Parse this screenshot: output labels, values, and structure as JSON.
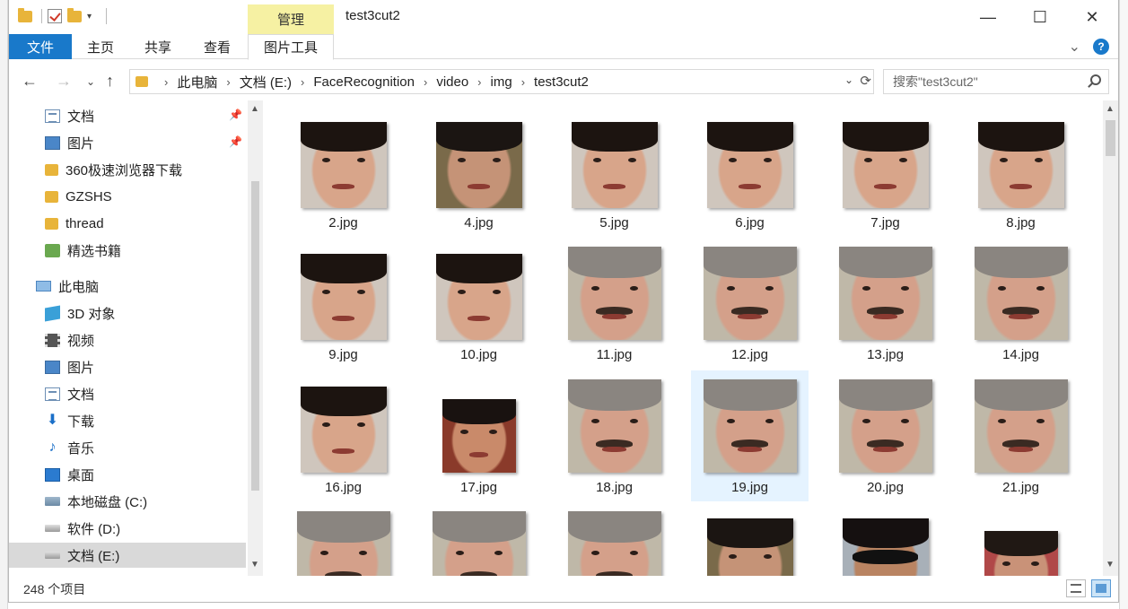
{
  "window": {
    "title": "test3cut2",
    "manage_tab": "管理",
    "minimize": "—",
    "maximize": "☐",
    "close": "✕"
  },
  "ribbon": {
    "tabs": [
      {
        "label": "文件"
      },
      {
        "label": "主页"
      },
      {
        "label": "共享"
      },
      {
        "label": "查看"
      },
      {
        "label": "图片工具"
      }
    ],
    "expand": "⌄",
    "help": "?"
  },
  "nav": {
    "back": "←",
    "forward": "→",
    "recent": "⌄",
    "up": "↑",
    "breadcrumb": [
      "此电脑",
      "文档 (E:)",
      "FaceRecognition",
      "video",
      "img",
      "test3cut2"
    ],
    "search_placeholder": "搜索\"test3cut2\""
  },
  "sidebar": {
    "items": [
      {
        "label": "文档",
        "icon": "document-icon",
        "pinned": true
      },
      {
        "label": "图片",
        "icon": "pictures-icon",
        "pinned": true
      },
      {
        "label": "360极速浏览器下载",
        "icon": "folder-icon"
      },
      {
        "label": "GZSHS",
        "icon": "folder-icon"
      },
      {
        "label": "thread",
        "icon": "folder-icon"
      },
      {
        "label": "精选书籍",
        "icon": "books-icon"
      },
      {
        "label": "此电脑",
        "icon": "computer-icon"
      },
      {
        "label": "3D 对象",
        "icon": "3d-objects-icon"
      },
      {
        "label": "视频",
        "icon": "videos-icon"
      },
      {
        "label": "图片",
        "icon": "pictures-icon"
      },
      {
        "label": "文档",
        "icon": "document-icon"
      },
      {
        "label": "下载",
        "icon": "download-icon"
      },
      {
        "label": "音乐",
        "icon": "music-icon"
      },
      {
        "label": "桌面",
        "icon": "desktop-icon"
      },
      {
        "label": "本地磁盘 (C:)",
        "icon": "windows-drive-icon"
      },
      {
        "label": "软件 (D:)",
        "icon": "drive-icon"
      },
      {
        "label": "文档 (E:)",
        "icon": "drive-icon",
        "selected": true
      }
    ]
  },
  "files": [
    {
      "name": "2.jpg",
      "kind": "boy"
    },
    {
      "name": "4.jpg",
      "kind": "man2"
    },
    {
      "name": "5.jpg",
      "kind": "boy"
    },
    {
      "name": "6.jpg",
      "kind": "boy"
    },
    {
      "name": "7.jpg",
      "kind": "boy"
    },
    {
      "name": "8.jpg",
      "kind": "boy"
    },
    {
      "name": "9.jpg",
      "kind": "boy"
    },
    {
      "name": "10.jpg",
      "kind": "boy"
    },
    {
      "name": "11.jpg",
      "kind": "gray"
    },
    {
      "name": "12.jpg",
      "kind": "gray"
    },
    {
      "name": "13.jpg",
      "kind": "gray"
    },
    {
      "name": "14.jpg",
      "kind": "gray"
    },
    {
      "name": "16.jpg",
      "kind": "boy"
    },
    {
      "name": "17.jpg",
      "kind": "smile"
    },
    {
      "name": "18.jpg",
      "kind": "gray"
    },
    {
      "name": "19.jpg",
      "kind": "gray",
      "selected": true
    },
    {
      "name": "20.jpg",
      "kind": "gray"
    },
    {
      "name": "21.jpg",
      "kind": "gray"
    },
    {
      "name": "",
      "kind": "gray"
    },
    {
      "name": "",
      "kind": "gray"
    },
    {
      "name": "",
      "kind": "gray"
    },
    {
      "name": "",
      "kind": "man2"
    },
    {
      "name": "",
      "kind": "sunglasses"
    },
    {
      "name": "",
      "kind": "man3"
    }
  ],
  "status": {
    "count": "248 个项目"
  }
}
